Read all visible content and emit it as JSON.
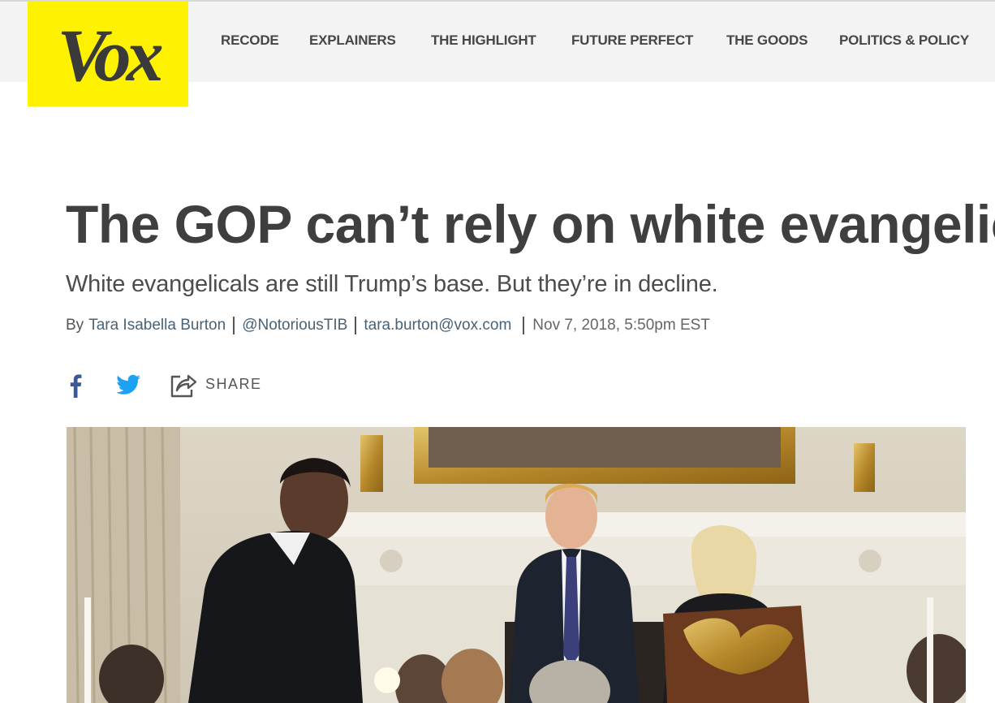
{
  "site": {
    "logo_text": "Vox",
    "brand_color": "#fff200"
  },
  "nav": {
    "items": [
      {
        "label": "RECODE"
      },
      {
        "label": "EXPLAINERS"
      },
      {
        "label": "THE HIGHLIGHT"
      },
      {
        "label": "FUTURE PERFECT"
      },
      {
        "label": "THE GOODS"
      },
      {
        "label": "POLITICS & POLICY"
      }
    ]
  },
  "article": {
    "headline": "The GOP can’t rely on white evangelicals forever",
    "dek": "White evangelicals are still Trump’s base. But they’re in decline.",
    "byline": {
      "prefix": "By",
      "author": "Tara Isabella Burton",
      "twitter": "@NotoriousTIB",
      "email": "tara.burton@vox.com",
      "date": "Nov 7, 2018, 5:50pm EST"
    },
    "share": {
      "label": "SHARE",
      "facebook_icon": "facebook-icon",
      "twitter_icon": "twitter-icon",
      "share_icon": "share-arrow-icon",
      "facebook_color": "#3b5998",
      "twitter_color": "#1da1f2"
    },
    "hero_image_icon": "photo"
  }
}
